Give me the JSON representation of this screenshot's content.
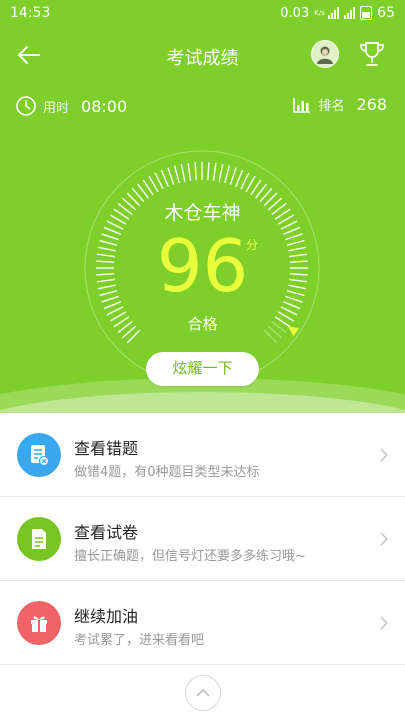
{
  "status_bar": {
    "time": "14:53",
    "net_speed": "0.03",
    "net_unit": "K/s",
    "battery": "65"
  },
  "header": {
    "title": "考试成绩",
    "back_icon": "arrow-left-icon",
    "avatar_icon": "avatar-icon",
    "trophy_icon": "trophy-icon"
  },
  "stats": {
    "time_label": "用时",
    "time_value": "08:00",
    "rank_label": "排名",
    "rank_value": "268"
  },
  "result": {
    "player_name": "木仓车神",
    "score": "96",
    "score_unit": "分",
    "verdict": "合格",
    "gauge_fraction": 0.96,
    "show_off_button": "炫耀一下"
  },
  "menu": [
    {
      "title": "查看错题",
      "subtitle": "做错4题，有0种题目类型未达标",
      "icon": "wrong-questions-icon",
      "color": "#3aa8ef"
    },
    {
      "title": "查看试卷",
      "subtitle": "擅长正确题，但信号灯还要多多练习哦~",
      "icon": "exam-paper-icon",
      "color": "#78c522"
    },
    {
      "title": "继续加油",
      "subtitle": "考试累了，进来看看吧",
      "icon": "gift-icon",
      "color": "#f06468"
    }
  ],
  "footer": {
    "scroll_top_icon": "chevron-up-icon"
  },
  "colors": {
    "primary_green": "#7fcf2b",
    "score_yellow": "#eaff3c"
  }
}
